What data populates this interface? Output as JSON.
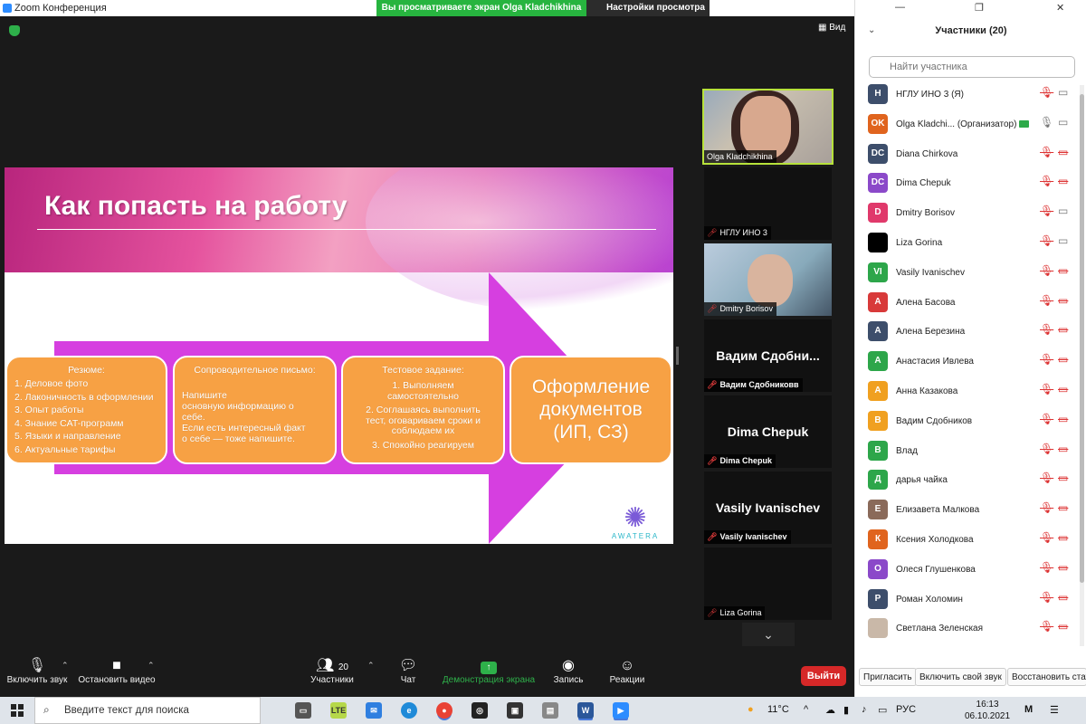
{
  "window": {
    "title": "Zoom Конференция"
  },
  "share_banner": {
    "text": "Вы просматриваете экран Olga Kladchikhina",
    "view_options": "Настройки просмотра"
  },
  "view_button": {
    "label": "Вид"
  },
  "slide": {
    "title": "Как попасть на работу",
    "box1": {
      "title": "Резюме:",
      "lines": [
        "1. Деловое фото",
        "2. Лаконичность в оформлении",
        "3. Опыт работы",
        "4. Знание CAT-программ",
        "5. Языки и направление",
        "6. Актуальные тарифы"
      ]
    },
    "box2": {
      "title": "Сопроводительное письмо:",
      "lines": [
        "Напишите",
        "основную информацию о",
        "себе.",
        "Если есть интересный факт",
        "о себе — тоже напишите."
      ]
    },
    "box3": {
      "title": "Тестовое задание:",
      "lines": [
        "1. Выполняем",
        "самостоятельно",
        "2. Соглашаясь выполнить",
        "тест, оговариваем сроки и",
        "соблюдаем их",
        "3. Спокойно реагируем"
      ]
    },
    "box4": {
      "lines": [
        "Оформление",
        "документов",
        "(ИП, СЗ)"
      ]
    },
    "logo_text": "AWATERA"
  },
  "tiles": [
    {
      "name": "Olga Kladchikhina",
      "type": "video"
    },
    {
      "name": "НГЛУ ИНО 3",
      "type": "black"
    },
    {
      "name": "Dmitry Borisov",
      "type": "video"
    },
    {
      "name": "Вадим Сдобниковв",
      "center": "Вадим Сдобни...",
      "type": "text"
    },
    {
      "name": "Dima Chepuk",
      "center": "Dima Chepuk",
      "type": "text"
    },
    {
      "name": "Vasily Ivanischev",
      "center": "Vasily Ivanischev",
      "type": "text"
    },
    {
      "name": "Liza Gorina",
      "type": "black"
    }
  ],
  "toolbar": {
    "unmute": "Включить звук",
    "stop_video": "Остановить видео",
    "participants": "Участники",
    "participants_count": "20",
    "chat": "Чат",
    "share": "Демонстрация экрана",
    "record": "Запись",
    "reactions": "Реакции",
    "leave": "Выйти"
  },
  "panel": {
    "title": "Участники (20)",
    "search_placeholder": "Найти участника",
    "participants": [
      {
        "initials": "Н",
        "name": "НГЛУ ИНО 3 (Я)",
        "color": "#3d4e6b",
        "mic": "muted",
        "video": "on"
      },
      {
        "initials": "OK",
        "name": "Olga Kladchi... (Организатор)",
        "color": "#e0641e",
        "mic": "on",
        "video": "on",
        "host": true
      },
      {
        "initials": "DC",
        "name": "Diana Chirkova",
        "color": "#3d4e6b",
        "mic": "muted",
        "video": "off"
      },
      {
        "initials": "DC",
        "name": "Dima Chepuk",
        "color": "#8b49c9",
        "mic": "muted",
        "video": "off"
      },
      {
        "initials": "D",
        "name": "Dmitry Borisov",
        "color": "#e0396b",
        "mic": "muted",
        "video": "on"
      },
      {
        "initials": "",
        "name": "Liza Gorina",
        "color": "#000000",
        "mic": "muted",
        "video": "on"
      },
      {
        "initials": "VI",
        "name": "Vasily Ivanischev",
        "color": "#2da64a",
        "mic": "muted",
        "video": "off"
      },
      {
        "initials": "А",
        "name": "Алена Басова",
        "color": "#d83a3a",
        "mic": "muted",
        "video": "off"
      },
      {
        "initials": "А",
        "name": "Алена Березина",
        "color": "#3d4e6b",
        "mic": "muted",
        "video": "off"
      },
      {
        "initials": "А",
        "name": "Анастасия Ивлева",
        "color": "#2da64a",
        "mic": "muted",
        "video": "off"
      },
      {
        "initials": "А",
        "name": "Анна Казакова",
        "color": "#f0a020",
        "mic": "muted",
        "video": "off"
      },
      {
        "initials": "В",
        "name": "Вадим Сдобников",
        "color": "#f0a020",
        "mic": "muted",
        "video": "off"
      },
      {
        "initials": "В",
        "name": "Влад",
        "color": "#2da64a",
        "mic": "muted",
        "video": "off"
      },
      {
        "initials": "Д",
        "name": "дарья чайка",
        "color": "#2da64a",
        "mic": "muted",
        "video": "off"
      },
      {
        "initials": "Е",
        "name": "Елизавета Малкова",
        "color": "#8a6a5a",
        "mic": "muted",
        "video": "off"
      },
      {
        "initials": "К",
        "name": "Ксения Холодкова",
        "color": "#e0641e",
        "mic": "muted",
        "video": "off"
      },
      {
        "initials": "О",
        "name": "Олеся Глушенкова",
        "color": "#8b49c9",
        "mic": "muted",
        "video": "off"
      },
      {
        "initials": "Р",
        "name": "Роман Холомин",
        "color": "#3d4e6b",
        "mic": "muted",
        "video": "off"
      },
      {
        "initials": "",
        "name": "Светлана Зеленская",
        "color": "#c9b8a8",
        "mic": "muted",
        "video": "off"
      }
    ],
    "footer": {
      "invite": "Пригласить",
      "unmute_self": "Включить свой звук",
      "restore": "Восстановить стату"
    }
  },
  "taskbar": {
    "search_placeholder": "Введите текст для поиска",
    "weather": "11°C",
    "lang": "РУС",
    "time": "16:13",
    "date": "06.10.2021"
  }
}
